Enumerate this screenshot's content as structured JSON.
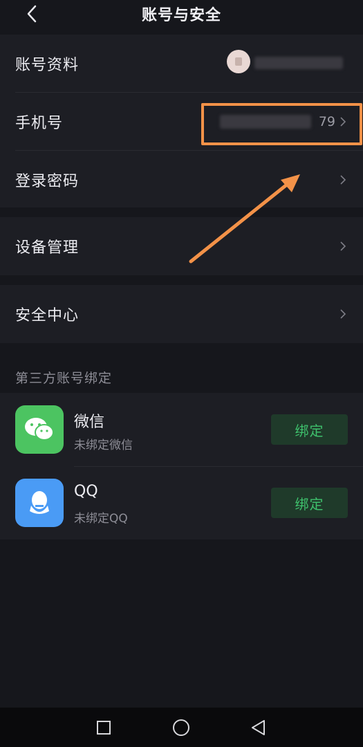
{
  "header": {
    "title": "账号与安全",
    "back_icon": "chevron-left-icon"
  },
  "group1": {
    "rows": [
      {
        "label": "账号资料"
      },
      {
        "label": "手机号",
        "value": "79"
      },
      {
        "label": "登录密码"
      }
    ]
  },
  "group2": {
    "rows": [
      {
        "label": "设备管理"
      }
    ]
  },
  "group3": {
    "rows": [
      {
        "label": "安全中心"
      }
    ]
  },
  "third_party": {
    "title": "第三方账号绑定",
    "items": [
      {
        "name": "微信",
        "status": "未绑定微信",
        "button": "绑定",
        "icon": "wechat-icon",
        "color": "#4cc461"
      },
      {
        "name": "QQ",
        "status": "未绑定QQ",
        "button": "绑定",
        "icon": "qq-icon",
        "color": "#4a9bf5"
      }
    ]
  },
  "annotation": {
    "color": "#f39248"
  },
  "nav": {
    "icons": [
      "recent-apps-icon",
      "home-icon",
      "back-icon"
    ]
  }
}
